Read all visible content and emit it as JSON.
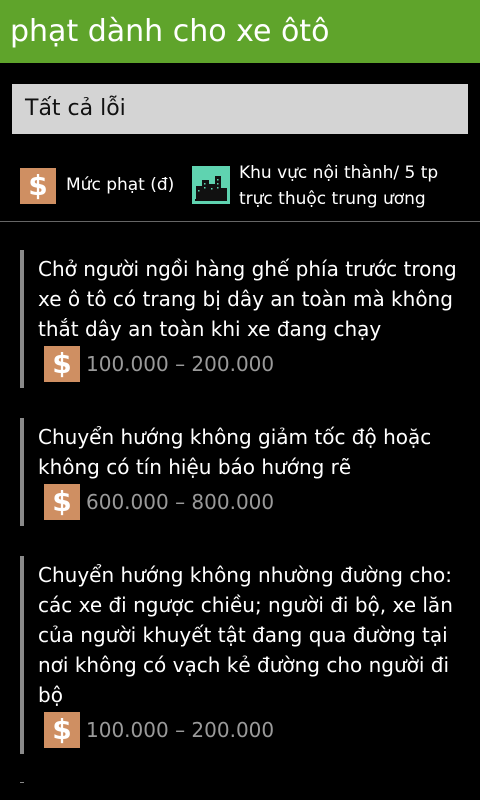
{
  "header": {
    "title": "phạt dành cho xe ôtô"
  },
  "filter": {
    "selected": "Tất cả lỗi"
  },
  "legend": {
    "fine_icon": "dollar-icon",
    "fine_label": "Mức phạt (đ)",
    "area_icon": "city-icon",
    "area_label": "Khu vực nội thành/ 5 tp trực thuộc trung ương"
  },
  "violations": [
    {
      "description": "Chở người ngồi hàng ghế phía trước trong xe ô tô có trang bị dây an toàn mà không thắt dây an toàn khi xe đang chạy",
      "fine": "100.000 – 200.000",
      "currency_symbol": "$"
    },
    {
      "description": "Chuyển hướng không giảm tốc độ hoặc không có tín hiệu báo hướng rẽ",
      "fine": "600.000 – 800.000",
      "currency_symbol": "$"
    },
    {
      "description": "Chuyển hướng không nhường đường cho: các xe đi ngược chiều; người đi bộ, xe lăn của người khuyết tật đang qua đường tại nơi không có vạch kẻ đường cho người đi bộ",
      "fine": "100.000 – 200.000",
      "currency_symbol": "$"
    }
  ],
  "colors": {
    "header_bg": "#5fa42b",
    "icon_bg": "#cf8f62",
    "city_icon_bg": "#5fd3b0",
    "item_border": "#8a8a8a",
    "fine_text": "#9a9a9a"
  }
}
